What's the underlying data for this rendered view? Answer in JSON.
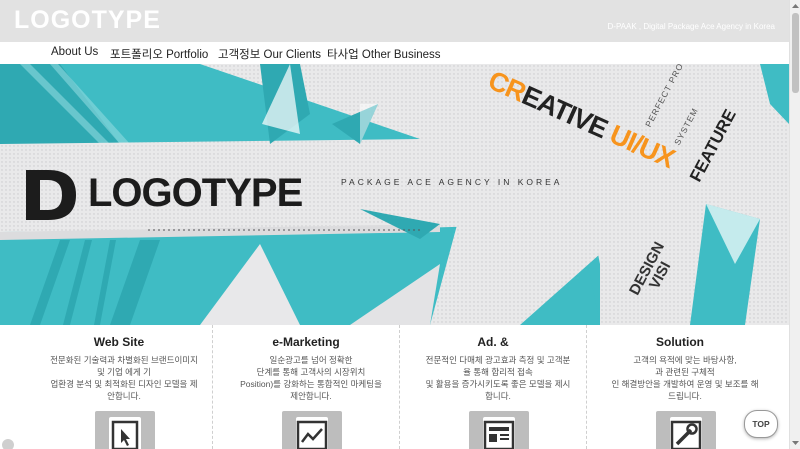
{
  "header": {
    "logo": "LOGOTYPE",
    "tagline": "D-PAAK , Digital Package Ace Agency in Korea"
  },
  "nav": {
    "items": [
      {
        "label": "About Us"
      },
      {
        "label": "포트폴리오 Portfolio"
      },
      {
        "label": "고객정보 Our Clients"
      },
      {
        "label": "타사업 Other Business"
      }
    ]
  },
  "hero": {
    "logo_letter": "D",
    "title": "LOGOTYPE",
    "subtitle": "PACKAGE ACE AGENCY IN KOREA",
    "creative_cr": "CR",
    "creative_rest": "EATIVE ",
    "creative_uiux": "UI/UX",
    "perfect": "PERFECT PROCE",
    "system": "SYSTEM",
    "feature": "FEATURE",
    "design": "DESIGN",
    "visi": "VISI"
  },
  "services": [
    {
      "title": "Web Site",
      "desc": [
        "전문화된 기술력과 차별화된 브랜드이미지",
        "및 기업                          에게 기",
        "업환경 분석 및 최적화된 디자인 모델을 제",
        "안합니다."
      ],
      "icon": "cursor-icon"
    },
    {
      "title": "e-Marketing",
      "desc": [
        "일순광고를 넘어 정확한",
        "단계를 통해 고객사의 시장위치",
        "Position)를 강화하는 통합적인 마케팅을",
        "제안합니다."
      ],
      "icon": "chart-icon"
    },
    {
      "title": "Ad. &",
      "desc": [
        "전문적인 다매체 광고효과 측정 및 고객분",
        "율 통해 합리적 접속",
        "및 활용을 증가시키도록 좋은 모델을 제시",
        "합니다."
      ],
      "icon": "layout-icon"
    },
    {
      "title": "Solution",
      "desc": [
        "고객의 욕적에 맞는 바탕사항,",
        "과 관련된 구체적",
        "인 해결방안을 개발하여 운영 및 보조를 해",
        "드립니다."
      ],
      "icon": "wrench-icon"
    }
  ],
  "top_button": "TOP",
  "colors": {
    "teal": "#3fbcc4",
    "orange": "#f7941d",
    "topbar": "#e2e2e2"
  }
}
